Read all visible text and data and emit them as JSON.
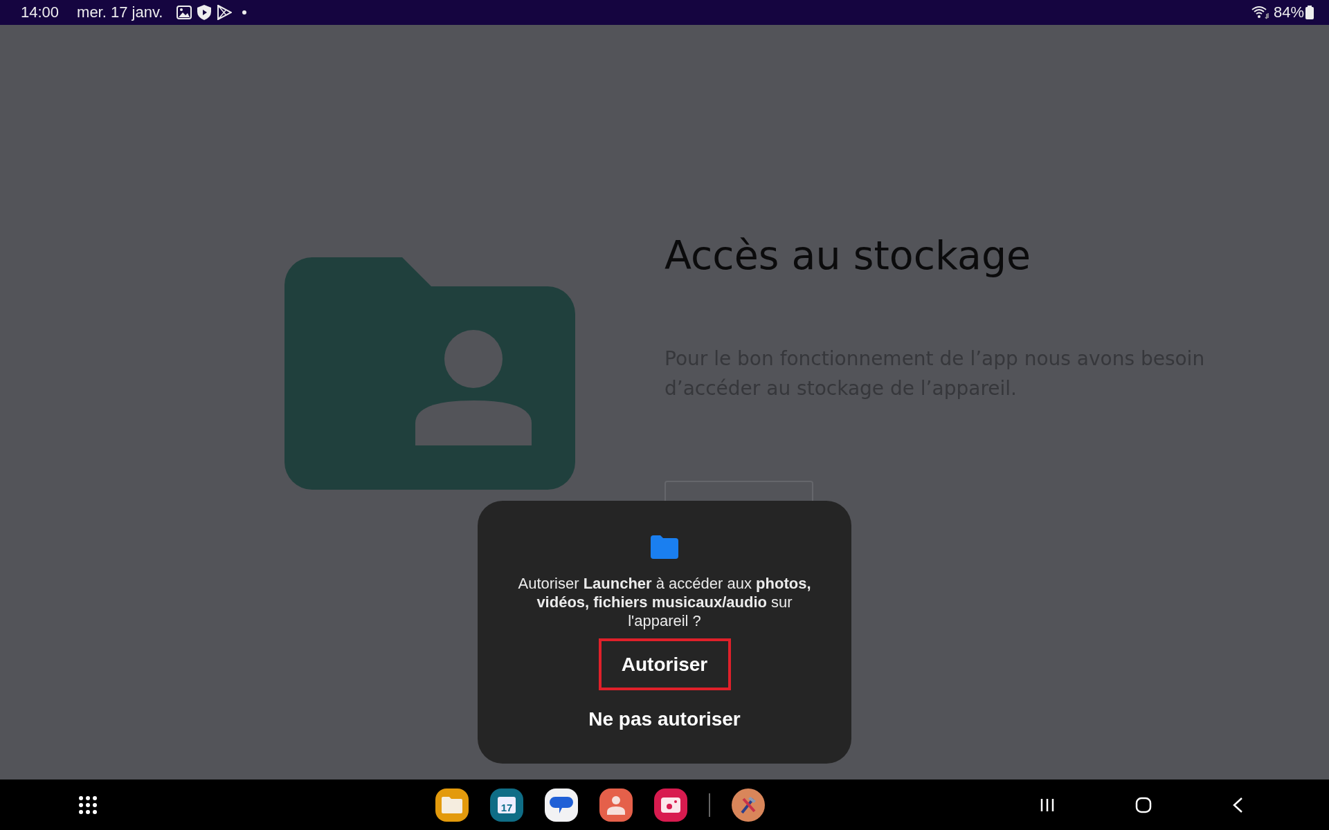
{
  "status_bar": {
    "time": "14:00",
    "date": "mer. 17 janv.",
    "battery_text": "84%"
  },
  "page": {
    "title": "Accès au stockage",
    "description": "Pour le bon fonctionnement de l’app nous avons besoin d’accéder au stockage de l’appareil."
  },
  "dialog": {
    "message": "Autoriser **Launcher** à accéder aux **photos, vidéos, fichiers musicaux/audio** sur l'appareil ?",
    "actions": [
      {
        "label": "Autoriser",
        "highlighted": true
      },
      {
        "label": "Ne pas autoriser",
        "highlighted": false
      }
    ]
  },
  "taskbar": {
    "dock": [
      {
        "kind": "files"
      },
      {
        "kind": "calendar",
        "label": "17"
      },
      {
        "kind": "messages"
      },
      {
        "kind": "contacts"
      },
      {
        "kind": "camera"
      },
      {
        "kind": "divider"
      },
      {
        "kind": "tools"
      }
    ]
  }
}
